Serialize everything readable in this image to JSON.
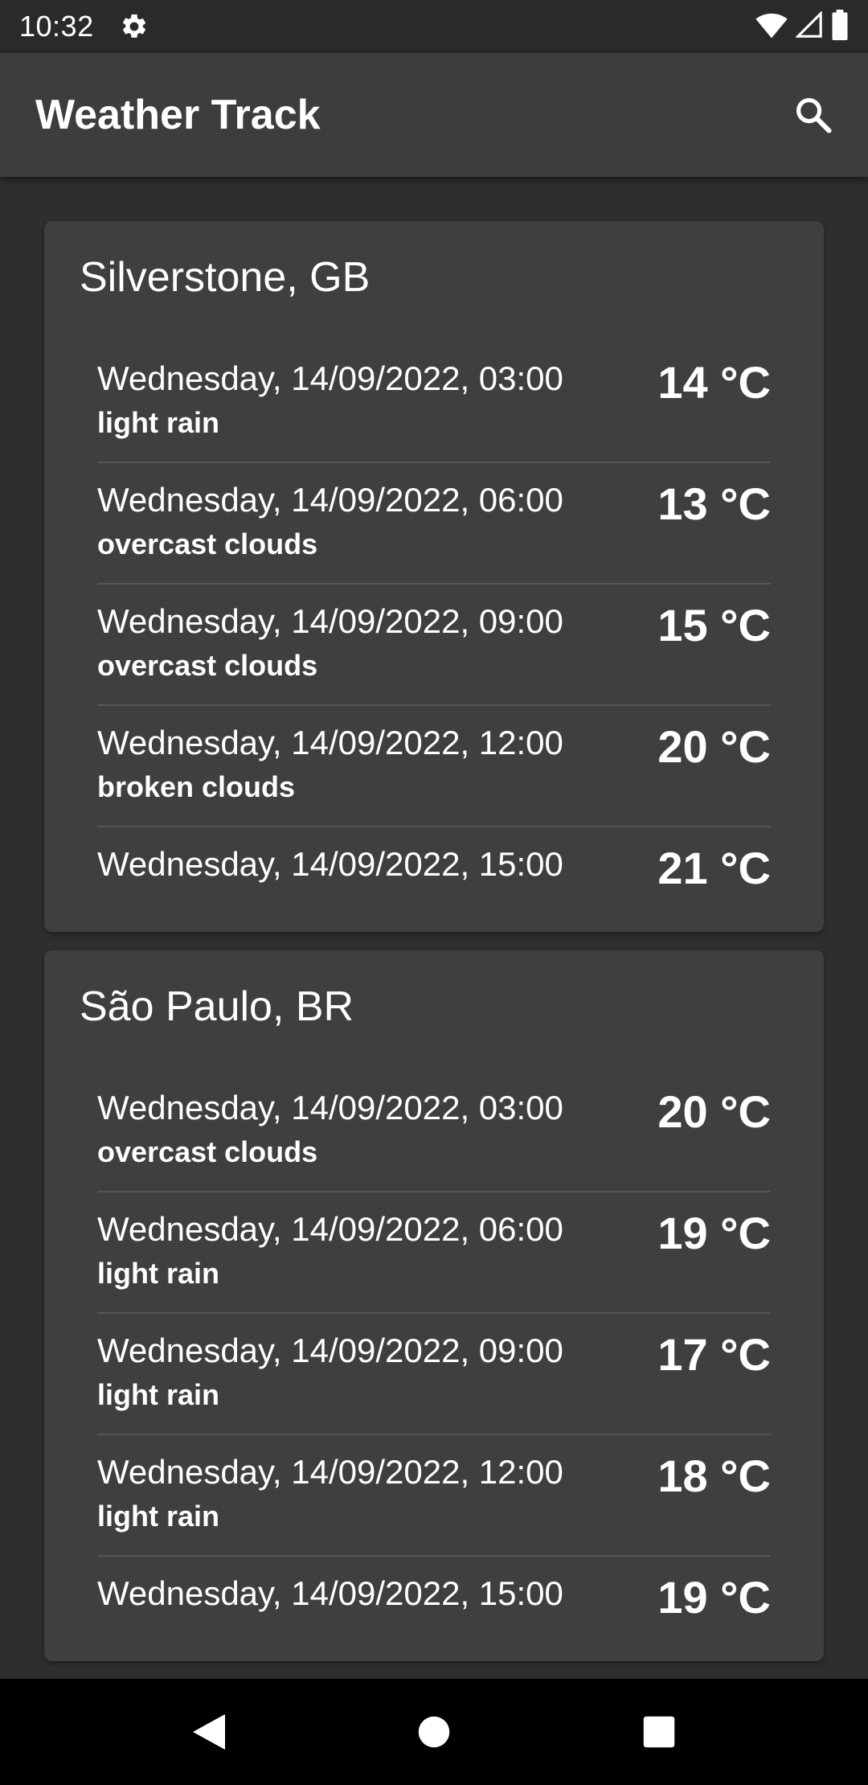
{
  "status_bar": {
    "time": "10:32",
    "icons": [
      "gear-icon",
      "wifi-icon",
      "signal-icon",
      "battery-icon"
    ]
  },
  "app_bar": {
    "title": "Weather Track",
    "search_icon": "search-icon"
  },
  "cities": [
    {
      "name": "Silverstone, GB",
      "forecasts": [
        {
          "datetime": "Wednesday, 14/09/2022, 03:00",
          "description": "light rain",
          "temp": "14 °C"
        },
        {
          "datetime": "Wednesday, 14/09/2022, 06:00",
          "description": "overcast clouds",
          "temp": "13 °C"
        },
        {
          "datetime": "Wednesday, 14/09/2022, 09:00",
          "description": "overcast clouds",
          "temp": "15 °C"
        },
        {
          "datetime": "Wednesday, 14/09/2022, 12:00",
          "description": "broken clouds",
          "temp": "20 °C"
        },
        {
          "datetime": "Wednesday, 14/09/2022, 15:00",
          "description": "",
          "temp": "21 °C"
        }
      ]
    },
    {
      "name": "São Paulo, BR",
      "forecasts": [
        {
          "datetime": "Wednesday, 14/09/2022, 03:00",
          "description": "overcast clouds",
          "temp": "20 °C"
        },
        {
          "datetime": "Wednesday, 14/09/2022, 06:00",
          "description": "light rain",
          "temp": "19 °C"
        },
        {
          "datetime": "Wednesday, 14/09/2022, 09:00",
          "description": "light rain",
          "temp": "17 °C"
        },
        {
          "datetime": "Wednesday, 14/09/2022, 12:00",
          "description": "light rain",
          "temp": "18 °C"
        },
        {
          "datetime": "Wednesday, 14/09/2022, 15:00",
          "description": "",
          "temp": "19 °C"
        }
      ]
    }
  ],
  "nav_bar": {
    "icons": [
      "back-icon",
      "home-icon",
      "recents-icon"
    ]
  },
  "colors": {
    "background": "#2e2e2e",
    "app_bar": "#3d3d3d",
    "card": "#3f3f3f",
    "divider": "#555555",
    "text": "#ffffff"
  }
}
